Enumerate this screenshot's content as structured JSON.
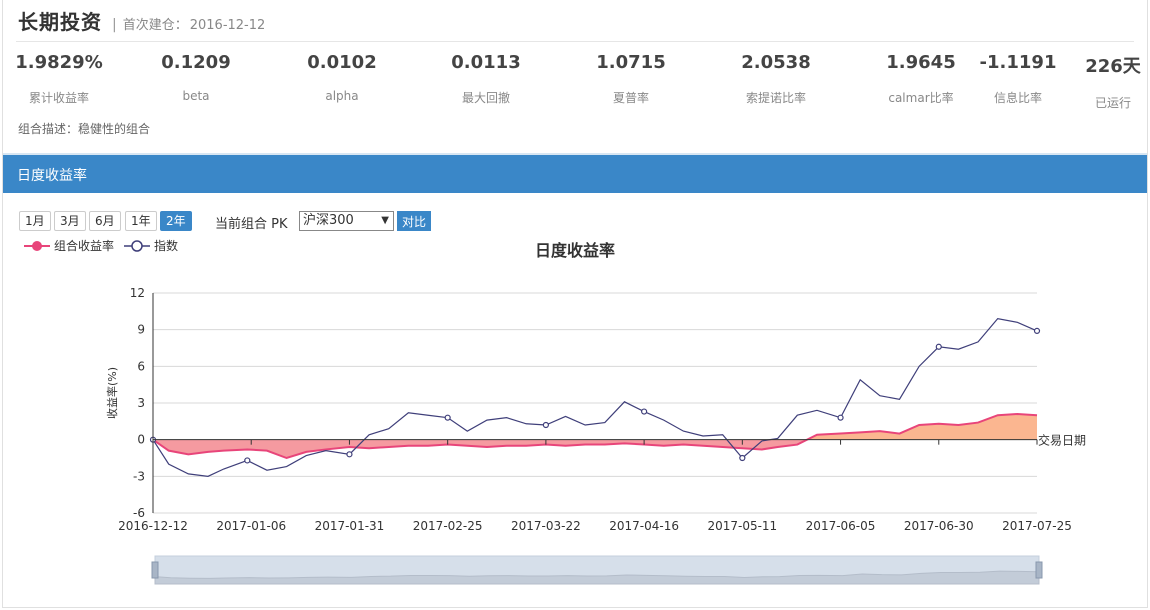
{
  "header": {
    "title": "长期投资",
    "divider": "|",
    "since_label": "首次建仓：",
    "since_date": "2016-12-12"
  },
  "stats": [
    {
      "value": "1.9829%",
      "label": "累计收益率"
    },
    {
      "value": "0.1209",
      "label": "beta"
    },
    {
      "value": "0.0102",
      "label": "alpha"
    },
    {
      "value": "0.0113",
      "label": "最大回撤"
    },
    {
      "value": "1.0715",
      "label": "夏普率"
    },
    {
      "value": "2.0538",
      "label": "索提诺比率"
    },
    {
      "value": "1.9645",
      "label": "calmar比率"
    },
    {
      "value": "-1.1191",
      "label": "信息比率"
    },
    {
      "value": "226天",
      "label": "已运行"
    }
  ],
  "description": "组合描述：稳健性的组合",
  "section_title": "日度收益率",
  "range_buttons": [
    "1月",
    "3月",
    "6月",
    "1年",
    "2年"
  ],
  "active_range": "2年",
  "pk_label": "当前组合 PK",
  "pk_selected": "沪深300",
  "compare_label": "对比",
  "colors": {
    "accent": "#3a87c8",
    "portfolio": "#e8457a",
    "portfolio_fill": "#f59aa0",
    "portfolio_fill_pos": "#fbb690",
    "index": "#3f3f7a"
  },
  "icons": [
    "dropdown-arrow-icon",
    "legend-circle-icon"
  ],
  "chart_data": {
    "type": "line",
    "title": "日度收益率",
    "ylabel": "收益率(%)",
    "xlabel": "交易日期",
    "ylim": [
      -6,
      12
    ],
    "yticks": [
      -6,
      -3,
      0,
      3,
      6,
      9,
      12
    ],
    "xticks": [
      "2016-12-12",
      "2017-01-06",
      "2017-01-31",
      "2017-02-25",
      "2017-03-22",
      "2017-04-16",
      "2017-05-11",
      "2017-06-05",
      "2017-06-30",
      "2017-07-25"
    ],
    "legend": [
      "组合收益率",
      "指数"
    ],
    "legend_position": "top-left",
    "grid": true,
    "series": [
      {
        "name": "组合收益率",
        "x": [
          "2016-12-12",
          "2016-12-16",
          "2016-12-21",
          "2016-12-26",
          "2016-12-30",
          "2017-01-05",
          "2017-01-10",
          "2017-01-15",
          "2017-01-20",
          "2017-01-25",
          "2017-01-31",
          "2017-02-05",
          "2017-02-10",
          "2017-02-15",
          "2017-02-20",
          "2017-02-25",
          "2017-03-02",
          "2017-03-07",
          "2017-03-12",
          "2017-03-17",
          "2017-03-22",
          "2017-03-27",
          "2017-04-01",
          "2017-04-06",
          "2017-04-11",
          "2017-04-16",
          "2017-04-21",
          "2017-04-26",
          "2017-05-01",
          "2017-05-06",
          "2017-05-11",
          "2017-05-16",
          "2017-05-20",
          "2017-05-25",
          "2017-05-30",
          "2017-06-05",
          "2017-06-10",
          "2017-06-15",
          "2017-06-20",
          "2017-06-25",
          "2017-06-30",
          "2017-07-05",
          "2017-07-10",
          "2017-07-15",
          "2017-07-20",
          "2017-07-25"
        ],
        "values": [
          0,
          -0.9,
          -1.2,
          -1.0,
          -0.9,
          -0.8,
          -0.9,
          -1.5,
          -1.0,
          -0.8,
          -0.6,
          -0.7,
          -0.6,
          -0.5,
          -0.5,
          -0.4,
          -0.5,
          -0.6,
          -0.5,
          -0.5,
          -0.4,
          -0.5,
          -0.4,
          -0.4,
          -0.3,
          -0.4,
          -0.5,
          -0.4,
          -0.5,
          -0.6,
          -0.7,
          -0.8,
          -0.6,
          -0.4,
          0.4,
          0.5,
          0.6,
          0.7,
          0.5,
          1.2,
          1.3,
          1.2,
          1.4,
          2.0,
          2.1,
          2.0
        ]
      },
      {
        "name": "指数",
        "x": [
          "2016-12-12",
          "2016-12-16",
          "2016-12-21",
          "2016-12-26",
          "2016-12-30",
          "2017-01-05",
          "2017-01-10",
          "2017-01-15",
          "2017-01-20",
          "2017-01-25",
          "2017-01-31",
          "2017-02-05",
          "2017-02-10",
          "2017-02-15",
          "2017-02-20",
          "2017-02-25",
          "2017-03-02",
          "2017-03-07",
          "2017-03-12",
          "2017-03-17",
          "2017-03-22",
          "2017-03-27",
          "2017-04-01",
          "2017-04-06",
          "2017-04-11",
          "2017-04-16",
          "2017-04-21",
          "2017-04-26",
          "2017-05-01",
          "2017-05-06",
          "2017-05-11",
          "2017-05-16",
          "2017-05-20",
          "2017-05-25",
          "2017-05-30",
          "2017-06-05",
          "2017-06-10",
          "2017-06-15",
          "2017-06-20",
          "2017-06-25",
          "2017-06-30",
          "2017-07-05",
          "2017-07-10",
          "2017-07-15",
          "2017-07-20",
          "2017-07-25"
        ],
        "values": [
          0,
          -2.0,
          -2.8,
          -3.0,
          -2.4,
          -1.7,
          -2.5,
          -2.2,
          -1.3,
          -0.9,
          -1.2,
          0.4,
          0.9,
          2.2,
          2.0,
          1.8,
          0.7,
          1.6,
          1.8,
          1.3,
          1.2,
          1.9,
          1.2,
          1.4,
          3.1,
          2.3,
          1.6,
          0.7,
          0.3,
          0.4,
          -1.5,
          -0.1,
          0.1,
          2.0,
          2.4,
          1.8,
          4.9,
          3.6,
          3.3,
          6.0,
          7.6,
          7.4,
          8.0,
          9.9,
          9.6,
          8.9
        ]
      }
    ]
  }
}
